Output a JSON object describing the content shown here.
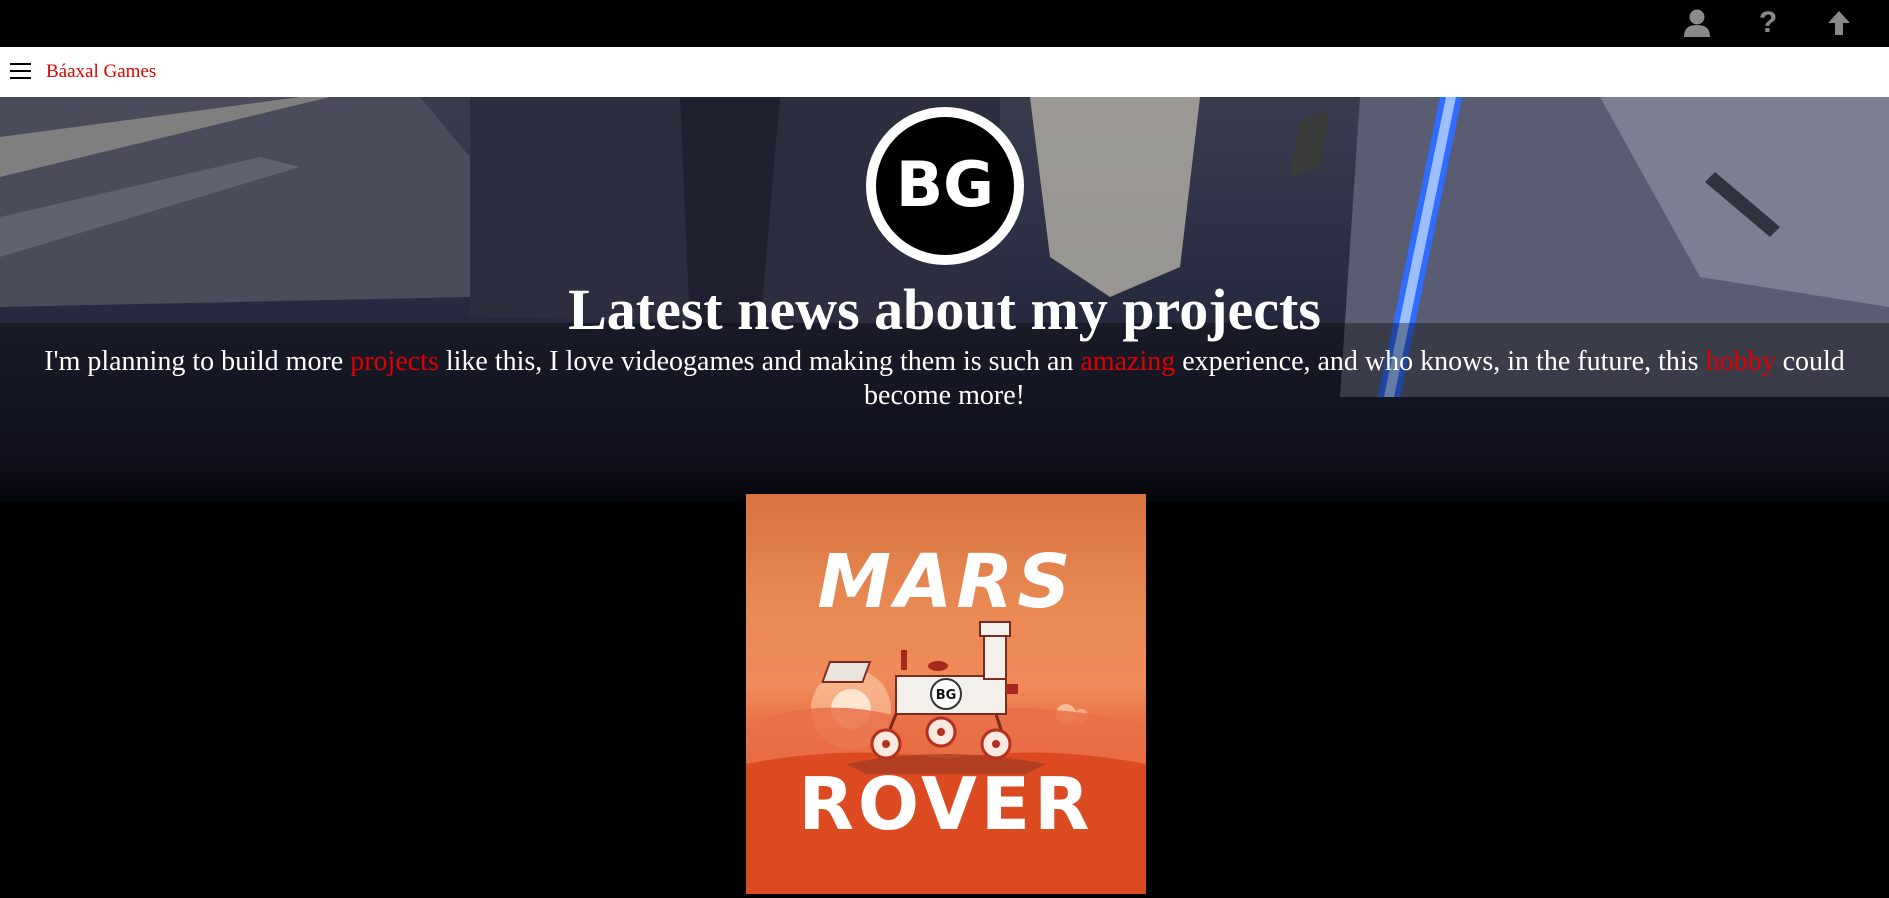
{
  "topbar": {
    "icons": [
      "user-icon",
      "help-icon",
      "arrow-up-icon"
    ],
    "help_glyph": "?"
  },
  "navbar": {
    "brand": "Báaxal Games",
    "menu_icon": "hamburger-menu-icon"
  },
  "hero": {
    "logo_text": "BG",
    "headline": "Latest news about my projects",
    "lead": {
      "p1": "I'm planning to build more ",
      "h1": "projects",
      "p2": " like this, I love videogames and making them is such an ",
      "h2": "amazing",
      "p3": " experience, and who knows, in the future, this ",
      "h3": "hobby",
      "p4": " could become more!"
    }
  },
  "project": {
    "title_line1": "MARS",
    "title_line2": "ROVER",
    "badge": "BG"
  },
  "colors": {
    "accent": "#e00000",
    "topbar_icon": "#8a8a8a",
    "background": "#000000"
  }
}
